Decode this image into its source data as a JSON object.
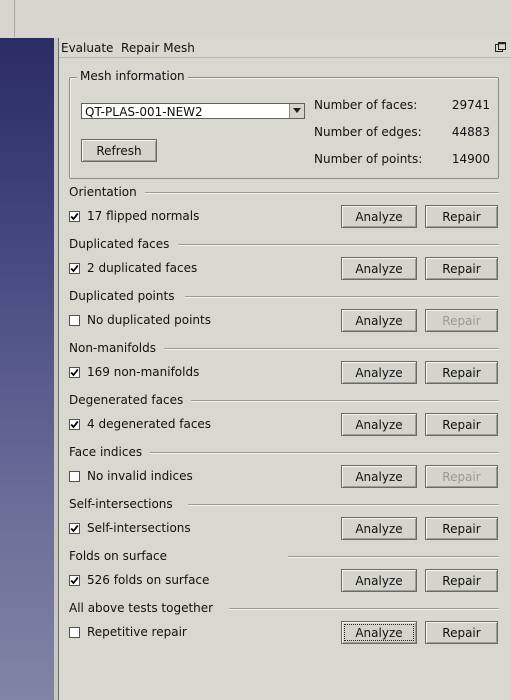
{
  "panel": {
    "title": "Evaluate  Repair Mesh"
  },
  "mesh_info": {
    "group_title": "Mesh information",
    "selected_mesh": "QT-PLAS-001-NEW2",
    "refresh_label": "Refresh",
    "stats": [
      {
        "label": "Number of faces:",
        "value": "29741"
      },
      {
        "label": "Number of edges:",
        "value": "44883"
      },
      {
        "label": "Number of points:",
        "value": "14900"
      }
    ]
  },
  "sections": [
    {
      "title": "Orientation",
      "check_label": "17 flipped normals",
      "checked": true,
      "analyze": "Analyze",
      "repair": "Repair",
      "repair_enabled": true
    },
    {
      "title": "Duplicated faces",
      "check_label": "2 duplicated faces",
      "checked": true,
      "analyze": "Analyze",
      "repair": "Repair",
      "repair_enabled": true
    },
    {
      "title": "Duplicated points",
      "check_label": "No duplicated points",
      "checked": false,
      "analyze": "Analyze",
      "repair": "Repair",
      "repair_enabled": false
    },
    {
      "title": "Non-manifolds",
      "check_label": "169 non-manifolds",
      "checked": true,
      "analyze": "Analyze",
      "repair": "Repair",
      "repair_enabled": true
    },
    {
      "title": "Degenerated faces",
      "check_label": "4 degenerated faces",
      "checked": true,
      "analyze": "Analyze",
      "repair": "Repair",
      "repair_enabled": true
    },
    {
      "title": "Face indices",
      "check_label": "No invalid indices",
      "checked": false,
      "analyze": "Analyze",
      "repair": "Repair",
      "repair_enabled": false
    },
    {
      "title": "Self-intersections",
      "check_label": "Self-intersections",
      "checked": true,
      "analyze": "Analyze",
      "repair": "Repair",
      "repair_enabled": true
    },
    {
      "title": "Folds on surface",
      "check_label": "526 folds on surface",
      "checked": true,
      "analyze": "Analyze",
      "repair": "Repair",
      "repair_enabled": true
    },
    {
      "title": "All above tests together",
      "check_label": "Repetitive repair",
      "checked": false,
      "analyze": "Analyze",
      "repair": "Repair",
      "repair_enabled": true
    }
  ],
  "icons": {
    "float": "float-window-icon",
    "dropdown": "chevron-down-icon",
    "check": "check-icon"
  }
}
